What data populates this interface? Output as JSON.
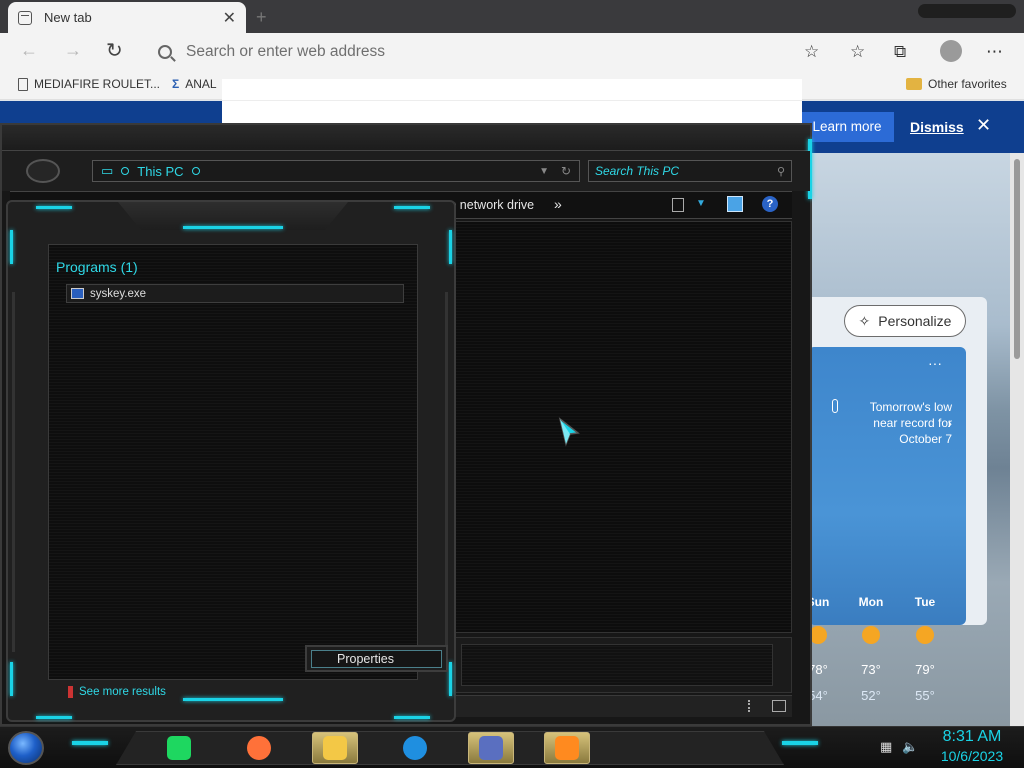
{
  "browser": {
    "tab_title": "New tab",
    "tab_close": "✕",
    "new_tab": "+",
    "address_placeholder": "Search or enter web address",
    "favorites": [
      {
        "label": "MEDIAFIRE ROULET..."
      },
      {
        "label": "ANAL"
      }
    ],
    "other_favorites": "Other favorites",
    "infobar": {
      "learn_more": "Learn more",
      "dismiss": "Dismiss",
      "close": "✕"
    },
    "personalize": "Personalize",
    "weather": {
      "alert": "Tomorrow's low near record for October 7",
      "dots": "···",
      "days": [
        {
          "day": "Sun",
          "hi": "78°",
          "lo": "54°"
        },
        {
          "day": "Mon",
          "hi": "73°",
          "lo": "52°"
        },
        {
          "day": "Tue",
          "hi": "79°",
          "lo": "55°"
        }
      ]
    }
  },
  "explorer": {
    "address": "This PC",
    "search_placeholder": "Search This PC",
    "cmd_map_drive": "Map network drive",
    "cmd_more": "»",
    "help": "?"
  },
  "startmenu": {
    "heading": "Programs (1)",
    "result": "syskey.exe",
    "see_more": "See more results"
  },
  "context_menu": {
    "properties": "Properties"
  },
  "taskbar": {
    "time": "8:31 AM",
    "date": "10/6/2023",
    "apps": [
      {
        "name": "notes-app",
        "color": "#1ed760"
      },
      {
        "name": "firefox",
        "color": "#ff7139"
      },
      {
        "name": "file-explorer",
        "color": "#f3c846"
      },
      {
        "name": "edge",
        "color": "#1f8fe0"
      },
      {
        "name": "media-app",
        "color": "#5a6fc0"
      },
      {
        "name": "media-player",
        "color": "#ff8a1f"
      }
    ]
  }
}
